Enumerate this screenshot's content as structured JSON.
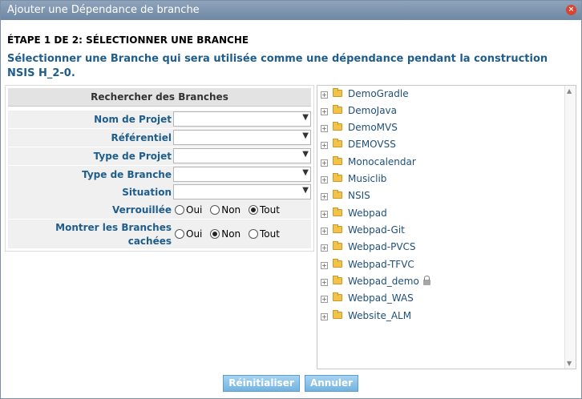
{
  "dialog": {
    "title": "Ajouter une Dépendance de branche",
    "close": "×"
  },
  "step": "ÉTAPE 1 DE 2: SÉLECTIONNER UNE BRANCHE",
  "description": "Sélectionner une Branche qui sera utilisée comme une dépendance pendant la construction NSIS H_2-0.",
  "search": {
    "header": "Rechercher des Branches",
    "fields": [
      {
        "label": "Nom de Projet",
        "value": ""
      },
      {
        "label": "Référentiel",
        "value": ""
      },
      {
        "label": "Type de Projet",
        "value": ""
      },
      {
        "label": "Type de Branche",
        "value": ""
      },
      {
        "label": "Situation",
        "value": ""
      }
    ],
    "locked": {
      "label": "Verrouillée",
      "options": [
        "Oui",
        "Non",
        "Tout"
      ],
      "selected": "Tout"
    },
    "hidden": {
      "label_line1": "Montrer les Branches",
      "label_line2": "cachées",
      "options": [
        "Oui",
        "Non",
        "Tout"
      ],
      "selected": "Non"
    }
  },
  "tree": {
    "expander": "+",
    "items": [
      {
        "label": "DemoGradle",
        "locked": false
      },
      {
        "label": "DemoJava",
        "locked": false
      },
      {
        "label": "DemoMVS",
        "locked": false
      },
      {
        "label": "DEMOVSS",
        "locked": false
      },
      {
        "label": "Monocalendar",
        "locked": false
      },
      {
        "label": "Musiclib",
        "locked": false
      },
      {
        "label": "NSIS",
        "locked": false
      },
      {
        "label": "Webpad",
        "locked": false
      },
      {
        "label": "Webpad-Git",
        "locked": false
      },
      {
        "label": "Webpad-PVCS",
        "locked": false
      },
      {
        "label": "Webpad-TFVC",
        "locked": false
      },
      {
        "label": "Webpad_demo",
        "locked": true
      },
      {
        "label": "Webpad_WAS",
        "locked": false
      },
      {
        "label": "Website_ALM",
        "locked": false
      }
    ]
  },
  "buttons": {
    "reset": "Réinitialiser",
    "cancel": "Annuler"
  },
  "colors": {
    "accent": "#1f5d8c",
    "titlebar": "#7a90aa",
    "button": "#8cc4ea"
  }
}
